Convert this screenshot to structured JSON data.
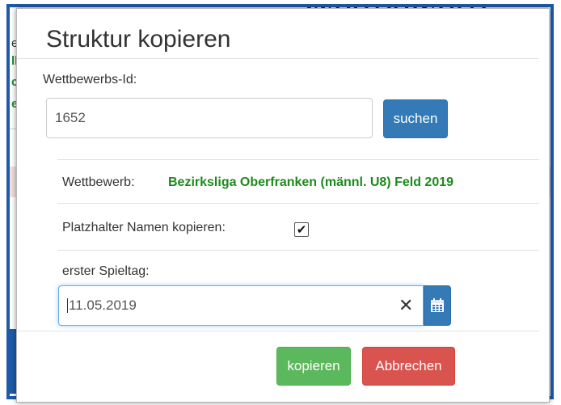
{
  "background": {
    "peek_letters": [
      "e",
      "ll",
      "c",
      "e"
    ],
    "title_fragment": "Wettbewerb"
  },
  "modal": {
    "title": "Struktur kopieren",
    "competition_id_label": "Wettbewerbs-Id:",
    "competition_id_value": "1652",
    "search_button": "suchen",
    "competition_label": "Wettbewerb:",
    "competition_value": "Bezirksliga Oberfranken (männl. U8) Feld 2019",
    "placeholder_names_label": "Platzhalter Namen kopieren:",
    "placeholder_names_checked": true,
    "first_matchday_label": "erster Spieltag:",
    "first_matchday_value": "11.05.2019",
    "copy_button": "kopieren",
    "cancel_button": "Abbrechen"
  },
  "colors": {
    "primary": "#337ab7",
    "success": "#5cb85c",
    "danger": "#d9534f",
    "competition_text": "#1d8a1d",
    "frame": "#1f5aa8"
  },
  "icons": {
    "clear": "close-icon",
    "calendar": "calendar-icon",
    "check": "checkmark-icon"
  }
}
